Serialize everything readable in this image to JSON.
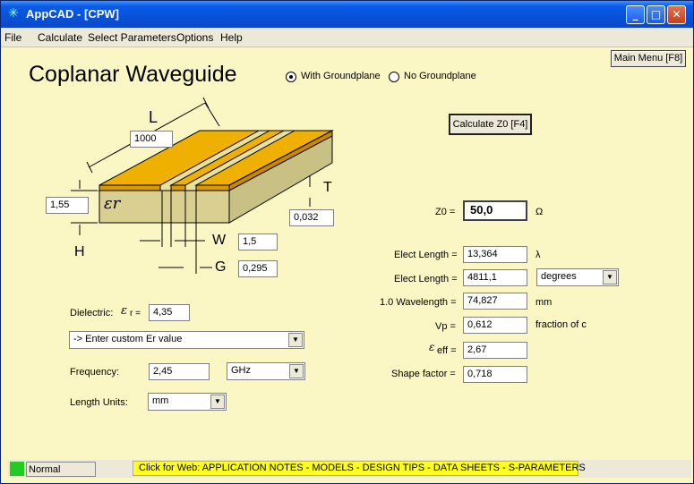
{
  "window": {
    "title": "AppCAD - [CPW]",
    "app_icon": "asterisk-icon"
  },
  "menu": [
    "File",
    "Calculate",
    "Select Parameters",
    "Options",
    "Help"
  ],
  "header": {
    "title": "Coplanar Waveguide",
    "radio_with": "With Groundplane",
    "radio_without": "No Groundplane",
    "with_selected": true,
    "main_menu_button": "Main Menu [F8]",
    "calculate_button": "Calculate Z0  [F4]"
  },
  "diagram": {
    "L_label": "L",
    "L_value": "1000",
    "er_symbol": "εr",
    "er_value": "1,55",
    "H_label": "H",
    "T_label": "T",
    "T_value": "0,032",
    "W_label": "W",
    "W_value": "1,5",
    "G_label": "G",
    "G_value": "0,295"
  },
  "inputs": {
    "dielectric_label": "Dielectric:",
    "dielectric_er_label": "r =",
    "dielectric_er_value": "4,35",
    "dielectric_select": "-> Enter custom Er value",
    "frequency_label": "Frequency:",
    "frequency_value": "2,45",
    "frequency_unit": "GHz",
    "length_units_label": "Length Units:",
    "length_units_value": "mm"
  },
  "results": {
    "z0_label": "Z0 =",
    "z0_value": "50,0",
    "z0_unit": "Ω",
    "elect_length_label": "Elect Length =",
    "elect_length_value": "13,364",
    "elect_length_unit": "λ",
    "elect_length2_label": "Elect Length =",
    "elect_length2_value": "4811,1",
    "elect_length2_unit": "degrees",
    "wavelength_label": "1.0 Wavelength =",
    "wavelength_value": "74,827",
    "wavelength_unit": "mm",
    "vp_label": "Vp =",
    "vp_value": "0,612",
    "vp_unit": "fraction of c",
    "eeff_label": "eff =",
    "eeff_value": "2,67",
    "shape_label": "Shape factor =",
    "shape_value": "0,718"
  },
  "status": {
    "mode": "Normal",
    "web_link": "Click for Web: APPLICATION NOTES - MODELS - DESIGN TIPS - DATA SHEETS - S-PARAMETERS"
  }
}
